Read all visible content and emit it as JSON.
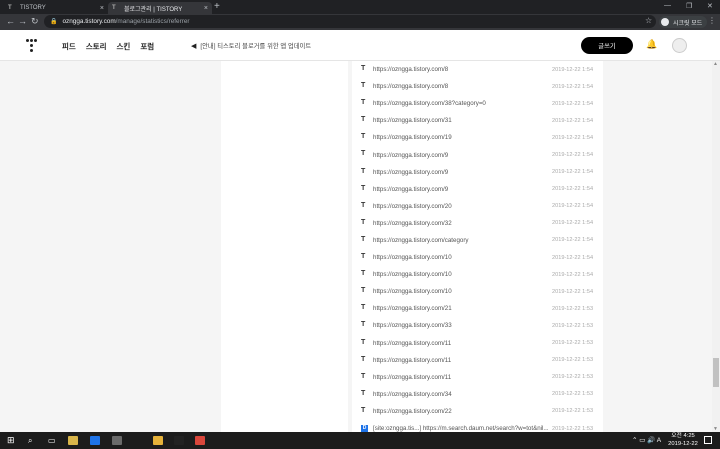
{
  "browser": {
    "tabs": [
      {
        "label": "TISTORY",
        "close": "×"
      },
      {
        "label": "블로그관리 | TISTORY",
        "close": "×"
      }
    ],
    "new_tab": "+",
    "window_controls": [
      "—",
      "❐",
      "✕"
    ],
    "nav": {
      "back": "←",
      "forward": "→",
      "reload": "↻"
    },
    "url_host": "ozngga.tistory.com",
    "url_path": "/manage/statistics/referrer",
    "lock_icon": "🔒",
    "bookmark_star": "☆",
    "profile_label": "시크릿 모드",
    "menu": "⋮"
  },
  "header": {
    "nav_items": [
      "피드",
      "스토리",
      "스킨",
      "포럼"
    ],
    "notice": "[안내] 티스토리 블로거를 위한 앱 업데이트",
    "write_button": "글쓰기",
    "bell": "🔔"
  },
  "referrer_rows": [
    {
      "url": "https://ozngga.tistory.com/8",
      "time": "2019-12-22 1:54",
      "source": "tistory"
    },
    {
      "url": "https://ozngga.tistory.com/8",
      "time": "2019-12-22 1:54",
      "source": "tistory"
    },
    {
      "url": "https://ozngga.tistory.com/38?category=0",
      "time": "2019-12-22 1:54",
      "source": "tistory"
    },
    {
      "url": "https://ozngga.tistory.com/31",
      "time": "2019-12-22 1:54",
      "source": "tistory"
    },
    {
      "url": "https://ozngga.tistory.com/19",
      "time": "2019-12-22 1:54",
      "source": "tistory"
    },
    {
      "url": "https://ozngga.tistory.com/9",
      "time": "2019-12-22 1:54",
      "source": "tistory"
    },
    {
      "url": "https://ozngga.tistory.com/9",
      "time": "2019-12-22 1:54",
      "source": "tistory"
    },
    {
      "url": "https://ozngga.tistory.com/9",
      "time": "2019-12-22 1:54",
      "source": "tistory"
    },
    {
      "url": "https://ozngga.tistory.com/20",
      "time": "2019-12-22 1:54",
      "source": "tistory"
    },
    {
      "url": "https://ozngga.tistory.com/32",
      "time": "2019-12-22 1:54",
      "source": "tistory"
    },
    {
      "url": "https://ozngga.tistory.com/category",
      "time": "2019-12-22 1:54",
      "source": "tistory"
    },
    {
      "url": "https://ozngga.tistory.com/10",
      "time": "2019-12-22 1:54",
      "source": "tistory"
    },
    {
      "url": "https://ozngga.tistory.com/10",
      "time": "2019-12-22 1:54",
      "source": "tistory"
    },
    {
      "url": "https://ozngga.tistory.com/10",
      "time": "2019-12-22 1:54",
      "source": "tistory"
    },
    {
      "url": "https://ozngga.tistory.com/21",
      "time": "2019-12-22 1:53",
      "source": "tistory"
    },
    {
      "url": "https://ozngga.tistory.com/33",
      "time": "2019-12-22 1:53",
      "source": "tistory"
    },
    {
      "url": "https://ozngga.tistory.com/11",
      "time": "2019-12-22 1:53",
      "source": "tistory"
    },
    {
      "url": "https://ozngga.tistory.com/11",
      "time": "2019-12-22 1:53",
      "source": "tistory"
    },
    {
      "url": "https://ozngga.tistory.com/11",
      "time": "2019-12-22 1:53",
      "source": "tistory"
    },
    {
      "url": "https://ozngga.tistory.com/34",
      "time": "2019-12-22 1:53",
      "source": "tistory"
    },
    {
      "url": "https://ozngga.tistory.com/22",
      "time": "2019-12-22 1:53",
      "source": "tistory"
    },
    {
      "url": "[site:ozngga.tis...] https://m.search.daum.net/search?w=tot&nil...",
      "time": "2019-12-22 1:53",
      "source": "daum"
    }
  ],
  "taskbar": {
    "start": "⊞",
    "search": "⌕",
    "taskview": "▭",
    "apps": [
      {
        "name": "file-explorer",
        "color": "#d9b54a"
      },
      {
        "name": "edge",
        "color": "#1e73e8"
      },
      {
        "name": "store",
        "color": "#6a6a6a"
      },
      {
        "name": "chrome",
        "color": "#e6b23a"
      },
      {
        "name": "app5",
        "color": "#222"
      },
      {
        "name": "app6",
        "color": "#d9463b"
      }
    ],
    "tray_icons": "⌃ ▭ 🔊 A",
    "time": "오전 4:25",
    "date": "2019-12-22"
  }
}
